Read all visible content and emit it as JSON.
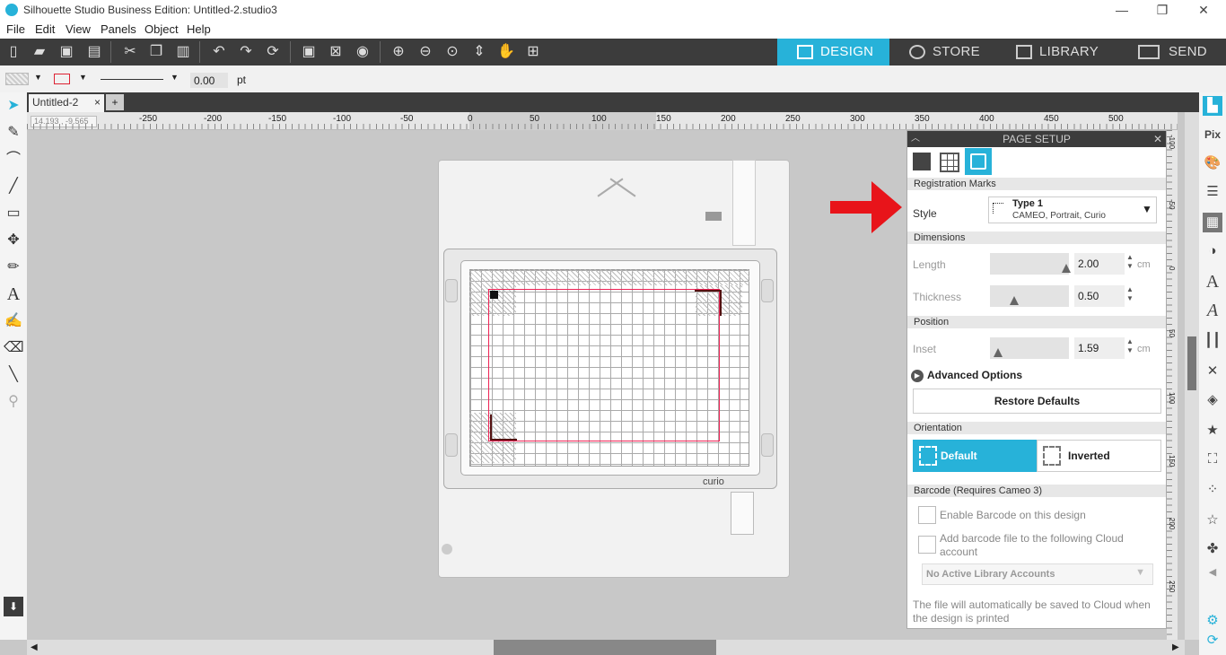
{
  "window": {
    "title": "Silhouette Studio Business Edition: Untitled-2.studio3",
    "minimize": "—",
    "restore": "❐",
    "close": "✕"
  },
  "menu": [
    "File",
    "Edit",
    "View",
    "Panels",
    "Object",
    "Help"
  ],
  "nav_tabs": [
    {
      "label": "DESIGN",
      "active": true
    },
    {
      "label": "STORE",
      "active": false
    },
    {
      "label": "LIBRARY",
      "active": false
    },
    {
      "label": "SEND",
      "active": false
    }
  ],
  "propbar": {
    "line_width": "0.00",
    "unit": "pt"
  },
  "doc_tab": {
    "label": "Untitled-2",
    "close": "×",
    "add": "+"
  },
  "ruler": {
    "coords": "14.193 , -9.565",
    "ticks": [
      "-250",
      "-200",
      "-150",
      "-100",
      "-50",
      "0",
      "50",
      "100",
      "150",
      "200",
      "250",
      "300",
      "350",
      "400",
      "450",
      "500"
    ]
  },
  "vruler_ticks": [
    "-100",
    "-50",
    "0",
    "50",
    "100",
    "150",
    "200",
    "250"
  ],
  "machine": {
    "brand": "curio"
  },
  "panel": {
    "title": "PAGE SETUP",
    "sections": {
      "reg": "Registration Marks",
      "dim": "Dimensions",
      "pos": "Position",
      "orient": "Orientation",
      "barcode": "Barcode (Requires Cameo 3)"
    },
    "style_label": "Style",
    "style_value": "Type 1",
    "style_sub": "CAMEO, Portrait, Curio",
    "length_label": "Length",
    "length_value": "2.00",
    "length_unit": "cm",
    "thickness_label": "Thickness",
    "thickness_value": "0.50",
    "inset_label": "Inset",
    "inset_value": "1.59",
    "inset_unit": "cm",
    "advanced": "Advanced Options",
    "restore": "Restore Defaults",
    "orient_default": "Default",
    "orient_inverted": "Inverted",
    "barcode_enable": "Enable Barcode on this design",
    "barcode_add": "Add barcode file to the following Cloud account",
    "library_select": "No Active Library Accounts",
    "footer": "The file will automatically be saved to Cloud when the design is printed"
  },
  "colors": {
    "accent": "#27b2d9",
    "toolbar": "#3c3c3c",
    "arrow": "#e8141a"
  }
}
